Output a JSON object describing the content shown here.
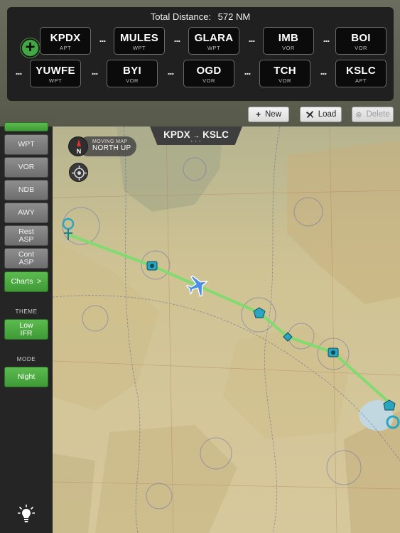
{
  "header": {
    "total_label": "Total Distance:",
    "total_value": "572 NM"
  },
  "route": {
    "add_icon": "plus-icon",
    "separator": "...",
    "waypoints": [
      {
        "id": "KPDX",
        "type": "APT"
      },
      {
        "id": "MULES",
        "type": "WPT"
      },
      {
        "id": "GLARA",
        "type": "WPT"
      },
      {
        "id": "IMB",
        "type": "VOR"
      },
      {
        "id": "BOI",
        "type": "VOR"
      },
      {
        "id": "YUWFE",
        "type": "WPT"
      },
      {
        "id": "BYI",
        "type": "VOR"
      },
      {
        "id": "OGD",
        "type": "VOR"
      },
      {
        "id": "TCH",
        "type": "VOR"
      },
      {
        "id": "KSLC",
        "type": "APT"
      }
    ]
  },
  "actions": {
    "new_label": "New",
    "load_label": "Load",
    "delete_label": "Delete"
  },
  "sidebar": {
    "buttons": [
      "WPT",
      "VOR",
      "NDB",
      "AWY"
    ],
    "rest_asp": [
      "Rest",
      "ASP"
    ],
    "cont_asp": [
      "Cont",
      "ASP"
    ],
    "charts_label": "Charts  >",
    "theme_heading": "THEME",
    "theme_value": [
      "Low",
      "IFR"
    ],
    "mode_heading": "MODE",
    "mode_value": "Night"
  },
  "map": {
    "route_from": "KPDX",
    "route_to": "KSLC",
    "route_arrow": "→",
    "moving_map_line1": "MOVING MAP",
    "moving_map_line2": "NORTH UP",
    "compass_letter": "N"
  },
  "colors": {
    "route_line": "#7ddc6e",
    "accent_green": "#43a843",
    "aircraft": "#4a8ee8",
    "nav_symbol": "#2aa5c0"
  }
}
